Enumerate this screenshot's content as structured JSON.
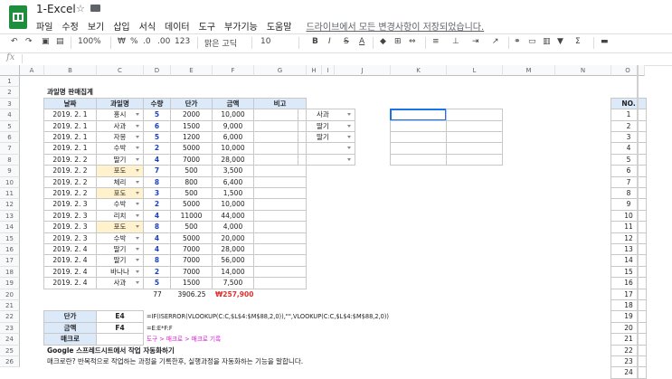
{
  "app": {
    "doc_title": "1-Excel",
    "star_icon": "star-icon",
    "folder_icon": "folder-icon"
  },
  "menu": {
    "items": [
      "파일",
      "수정",
      "보기",
      "삽입",
      "서식",
      "데이터",
      "도구",
      "부가기능",
      "도움말"
    ],
    "saved_notice": "드라이브에서 모든 변경사항이 저장되었습니다."
  },
  "toolbar": {
    "zoom": "100%",
    "currency": "₩",
    "percent": "%",
    "dec_down": ".0",
    "dec_up": ".00",
    "format_more": "123",
    "font": "맑은 고딕",
    "font_size": "10",
    "bold": "B",
    "italic": "I",
    "strike": "S",
    "text_color": "A"
  },
  "formula_bar": {
    "fx": "fx"
  },
  "columns": [
    "A",
    "B",
    "C",
    "D",
    "E",
    "F",
    "G",
    "H",
    "I",
    "J",
    "K",
    "L",
    "M",
    "N",
    "O"
  ],
  "rows": [
    "1",
    "2",
    "3",
    "4",
    "5",
    "6",
    "7",
    "8",
    "9",
    "10",
    "11",
    "12",
    "13",
    "14",
    "15",
    "16",
    "17",
    "18",
    "19",
    "20",
    "21",
    "22",
    "23",
    "24",
    "25",
    "26"
  ],
  "sheet": {
    "title": "과일명 판매집계",
    "headers": [
      "날짜",
      "과일명",
      "수량",
      "단가",
      "금액",
      "비고"
    ],
    "records": [
      {
        "date": "2019. 2. 1",
        "fruit": "홍시",
        "qty": "5",
        "price": "2000",
        "amount": "10,000"
      },
      {
        "date": "2019. 2. 1",
        "fruit": "사과",
        "qty": "6",
        "price": "1500",
        "amount": "9,000"
      },
      {
        "date": "2019. 2. 1",
        "fruit": "자몽",
        "qty": "5",
        "price": "1200",
        "amount": "6,000"
      },
      {
        "date": "2019. 2. 1",
        "fruit": "수박",
        "qty": "2",
        "price": "5000",
        "amount": "10,000"
      },
      {
        "date": "2019. 2. 2",
        "fruit": "딸기",
        "qty": "4",
        "price": "7000",
        "amount": "28,000"
      },
      {
        "date": "2019. 2. 2",
        "fruit": "포도",
        "qty": "7",
        "price": "500",
        "amount": "3,500"
      },
      {
        "date": "2019. 2. 2",
        "fruit": "체리",
        "qty": "8",
        "price": "800",
        "amount": "6,400"
      },
      {
        "date": "2019. 2. 2",
        "fruit": "포도",
        "qty": "3",
        "price": "500",
        "amount": "1,500"
      },
      {
        "date": "2019. 2. 3",
        "fruit": "수박",
        "qty": "2",
        "price": "5000",
        "amount": "10,000"
      },
      {
        "date": "2019. 2. 3",
        "fruit": "리치",
        "qty": "4",
        "price": "11000",
        "amount": "44,000"
      },
      {
        "date": "2019. 2. 3",
        "fruit": "포도",
        "qty": "8",
        "price": "500",
        "amount": "4,000"
      },
      {
        "date": "2019. 2. 3",
        "fruit": "수박",
        "qty": "4",
        "price": "5000",
        "amount": "20,000"
      },
      {
        "date": "2019. 2. 4",
        "fruit": "딸기",
        "qty": "4",
        "price": "7000",
        "amount": "28,000"
      },
      {
        "date": "2019. 2. 4",
        "fruit": "딸기",
        "qty": "8",
        "price": "7000",
        "amount": "56,000"
      },
      {
        "date": "2019. 2. 4",
        "fruit": "바나나",
        "qty": "2",
        "price": "7000",
        "amount": "14,000"
      },
      {
        "date": "2019. 2. 4",
        "fruit": "사과",
        "qty": "5",
        "price": "1500",
        "amount": "7,500"
      }
    ],
    "totals": {
      "qty": "77",
      "price": "3906.25",
      "amount": "₩257,900"
    },
    "lookup": [
      {
        "label": "단가",
        "value": "E4",
        "note": "=IF(ISERROR(VLOOKUP(C:C,$L$4:$M$88,2,0)),\"\",VLOOKUP(C:C,$L$4:$M$88,2,0))"
      },
      {
        "label": "금액",
        "value": "F4",
        "note": "=E:E*F:F"
      },
      {
        "label": "매크로",
        "value": "",
        "note": "도구 > 매크로 > 매크로 기록"
      }
    ],
    "side_list": [
      "사과",
      "딸기",
      "딸기",
      "",
      ""
    ],
    "no_header": "NO.",
    "no_values": [
      "1",
      "2",
      "3",
      "4",
      "5",
      "6",
      "7",
      "8",
      "9",
      "10",
      "11",
      "12",
      "13",
      "14",
      "15",
      "16",
      "17",
      "18",
      "19",
      "20",
      "21",
      "22",
      "23",
      "24"
    ],
    "footer_heading": "Google 스프레드시트에서 작업 자동화하기",
    "footer_text": "매크로란? 반복적으로 작업하는 과정을 기록한후, 실행과정을 자동화하는 기능을 말합니다."
  }
}
